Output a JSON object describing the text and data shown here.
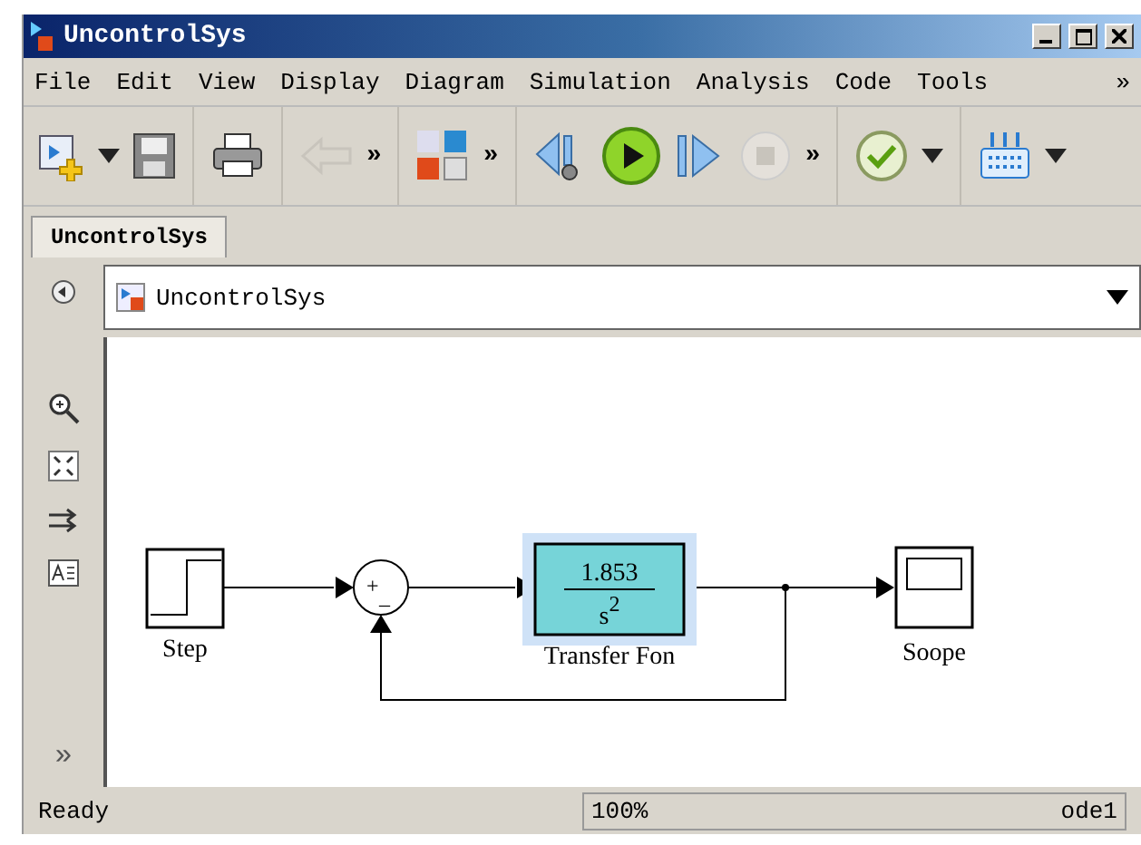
{
  "window": {
    "title": "UncontrolSys"
  },
  "menu": {
    "items": [
      "File",
      "Edit",
      "View",
      "Display",
      "Diagram",
      "Simulation",
      "Analysis",
      "Code",
      "Tools"
    ],
    "overflow": "»"
  },
  "toolbar": [
    {
      "kind": "new",
      "disabled": false
    },
    {
      "kind": "dropdown",
      "disabled": false
    },
    {
      "kind": "save",
      "disabled": false
    },
    {
      "kind": "sep"
    },
    {
      "kind": "print",
      "disabled": false
    },
    {
      "kind": "sep"
    },
    {
      "kind": "back",
      "disabled": true
    },
    {
      "kind": "more",
      "text": "»"
    },
    {
      "kind": "sep"
    },
    {
      "kind": "library",
      "disabled": false
    },
    {
      "kind": "more",
      "text": "»"
    },
    {
      "kind": "sep"
    },
    {
      "kind": "step-back",
      "disabled": false
    },
    {
      "kind": "run",
      "disabled": false
    },
    {
      "kind": "step-forward",
      "disabled": false
    },
    {
      "kind": "stop",
      "disabled": true
    },
    {
      "kind": "more",
      "text": "»"
    },
    {
      "kind": "sep"
    },
    {
      "kind": "check",
      "disabled": false
    },
    {
      "kind": "dropdown",
      "disabled": false
    },
    {
      "kind": "sep"
    },
    {
      "kind": "grid",
      "disabled": false
    },
    {
      "kind": "dropdown",
      "disabled": false
    }
  ],
  "tabs": [
    {
      "label": "UncontrolSys",
      "selected": true
    }
  ],
  "address": {
    "path": "UncontrolSys"
  },
  "palette": {
    "overflow": "»"
  },
  "diagram": {
    "blocks": [
      {
        "kind": "step",
        "label": "Step",
        "selected": false
      },
      {
        "kind": "sum",
        "signs": [
          "+",
          "_"
        ],
        "selected": false
      },
      {
        "kind": "transfer",
        "numerator": "1.853",
        "denominator": "s",
        "power": "2",
        "label": "Transfer Fon",
        "selected": true
      },
      {
        "kind": "scope",
        "label": "Soope",
        "selected": false
      }
    ]
  },
  "status_bar": {
    "state": "Ready",
    "zoom": "100%",
    "solver": "ode1"
  }
}
